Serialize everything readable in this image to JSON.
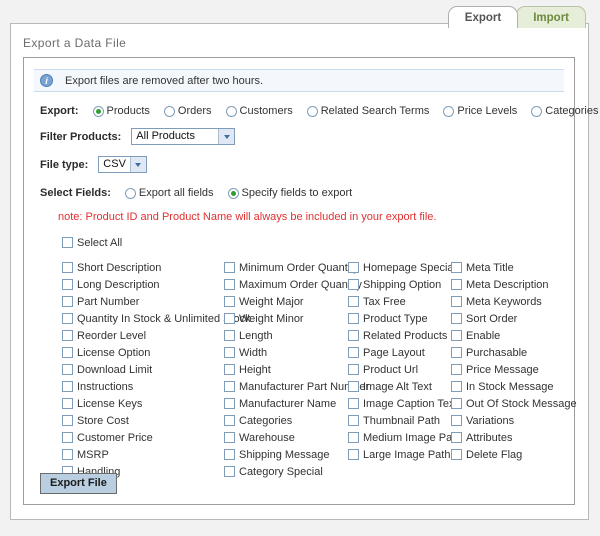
{
  "tabs": [
    {
      "label": "Export",
      "active": true
    },
    {
      "label": "Import",
      "active": false
    }
  ],
  "panel": {
    "title": "Export a Data File"
  },
  "info": {
    "icon": "info-icon",
    "text": "Export files are removed after two hours."
  },
  "export_type": {
    "label": "Export:",
    "options": [
      {
        "label": "Products",
        "selected": true
      },
      {
        "label": "Orders",
        "selected": false
      },
      {
        "label": "Customers",
        "selected": false
      },
      {
        "label": "Related Search Terms",
        "selected": false
      },
      {
        "label": "Price Levels",
        "selected": false
      },
      {
        "label": "Categories",
        "selected": false
      }
    ]
  },
  "filter_products": {
    "label": "Filter Products:",
    "value": "All Products"
  },
  "file_type": {
    "label": "File type:",
    "value": "CSV"
  },
  "select_fields": {
    "label": "Select Fields:",
    "options": [
      {
        "label": "Export all fields",
        "selected": false
      },
      {
        "label": "Specify fields to export",
        "selected": true
      }
    ],
    "note": "note: Product ID and Product Name will always be included in your export file.",
    "select_all_label": "Select All"
  },
  "field_columns": [
    {
      "items": [
        "Short Description",
        "Long Description",
        "Part Number",
        "Quantity In Stock & Unlimited Stock",
        "Reorder Level",
        "License Option",
        "Download Limit",
        "Instructions",
        "License Keys",
        "Store Cost",
        "Customer Price",
        "MSRP",
        "Handling"
      ]
    },
    {
      "items": [
        "Minimum Order Quantity",
        "Maximum Order Quantity",
        "Weight Major",
        "Weight Minor",
        "Length",
        "Width",
        "Height",
        "Manufacturer Part Number",
        "Manufacturer Name",
        "Categories",
        "Warehouse",
        "Shipping Message",
        "Category Special"
      ]
    },
    {
      "items": [
        "Homepage Special",
        "Shipping Option",
        "Tax Free",
        "Product Type",
        "Related Products",
        "Page Layout",
        "Product Url",
        "Image Alt Text",
        "Image Caption Text",
        "Thumbnail Path",
        "Medium Image Path",
        "Large Image Path"
      ]
    },
    {
      "items": [
        "Meta Title",
        "Meta Description",
        "Meta Keywords",
        "Sort Order",
        "Enable",
        "Purchasable",
        "Price Message",
        "In Stock Message",
        "Out Of Stock Message",
        "Variations",
        "Attributes",
        "Delete Flag"
      ]
    }
  ],
  "actions": {
    "export_file_label": "Export File"
  },
  "colors": {
    "active_tab_text": "#555555",
    "inactive_tab_bg": "#e6edd9",
    "inactive_tab_text": "#6f8a3f",
    "note_text": "#e03030",
    "radio_dot": "#2e9e2e",
    "button_bg": "#b9cee0",
    "info_bar_bg": "#f4f8fd"
  }
}
